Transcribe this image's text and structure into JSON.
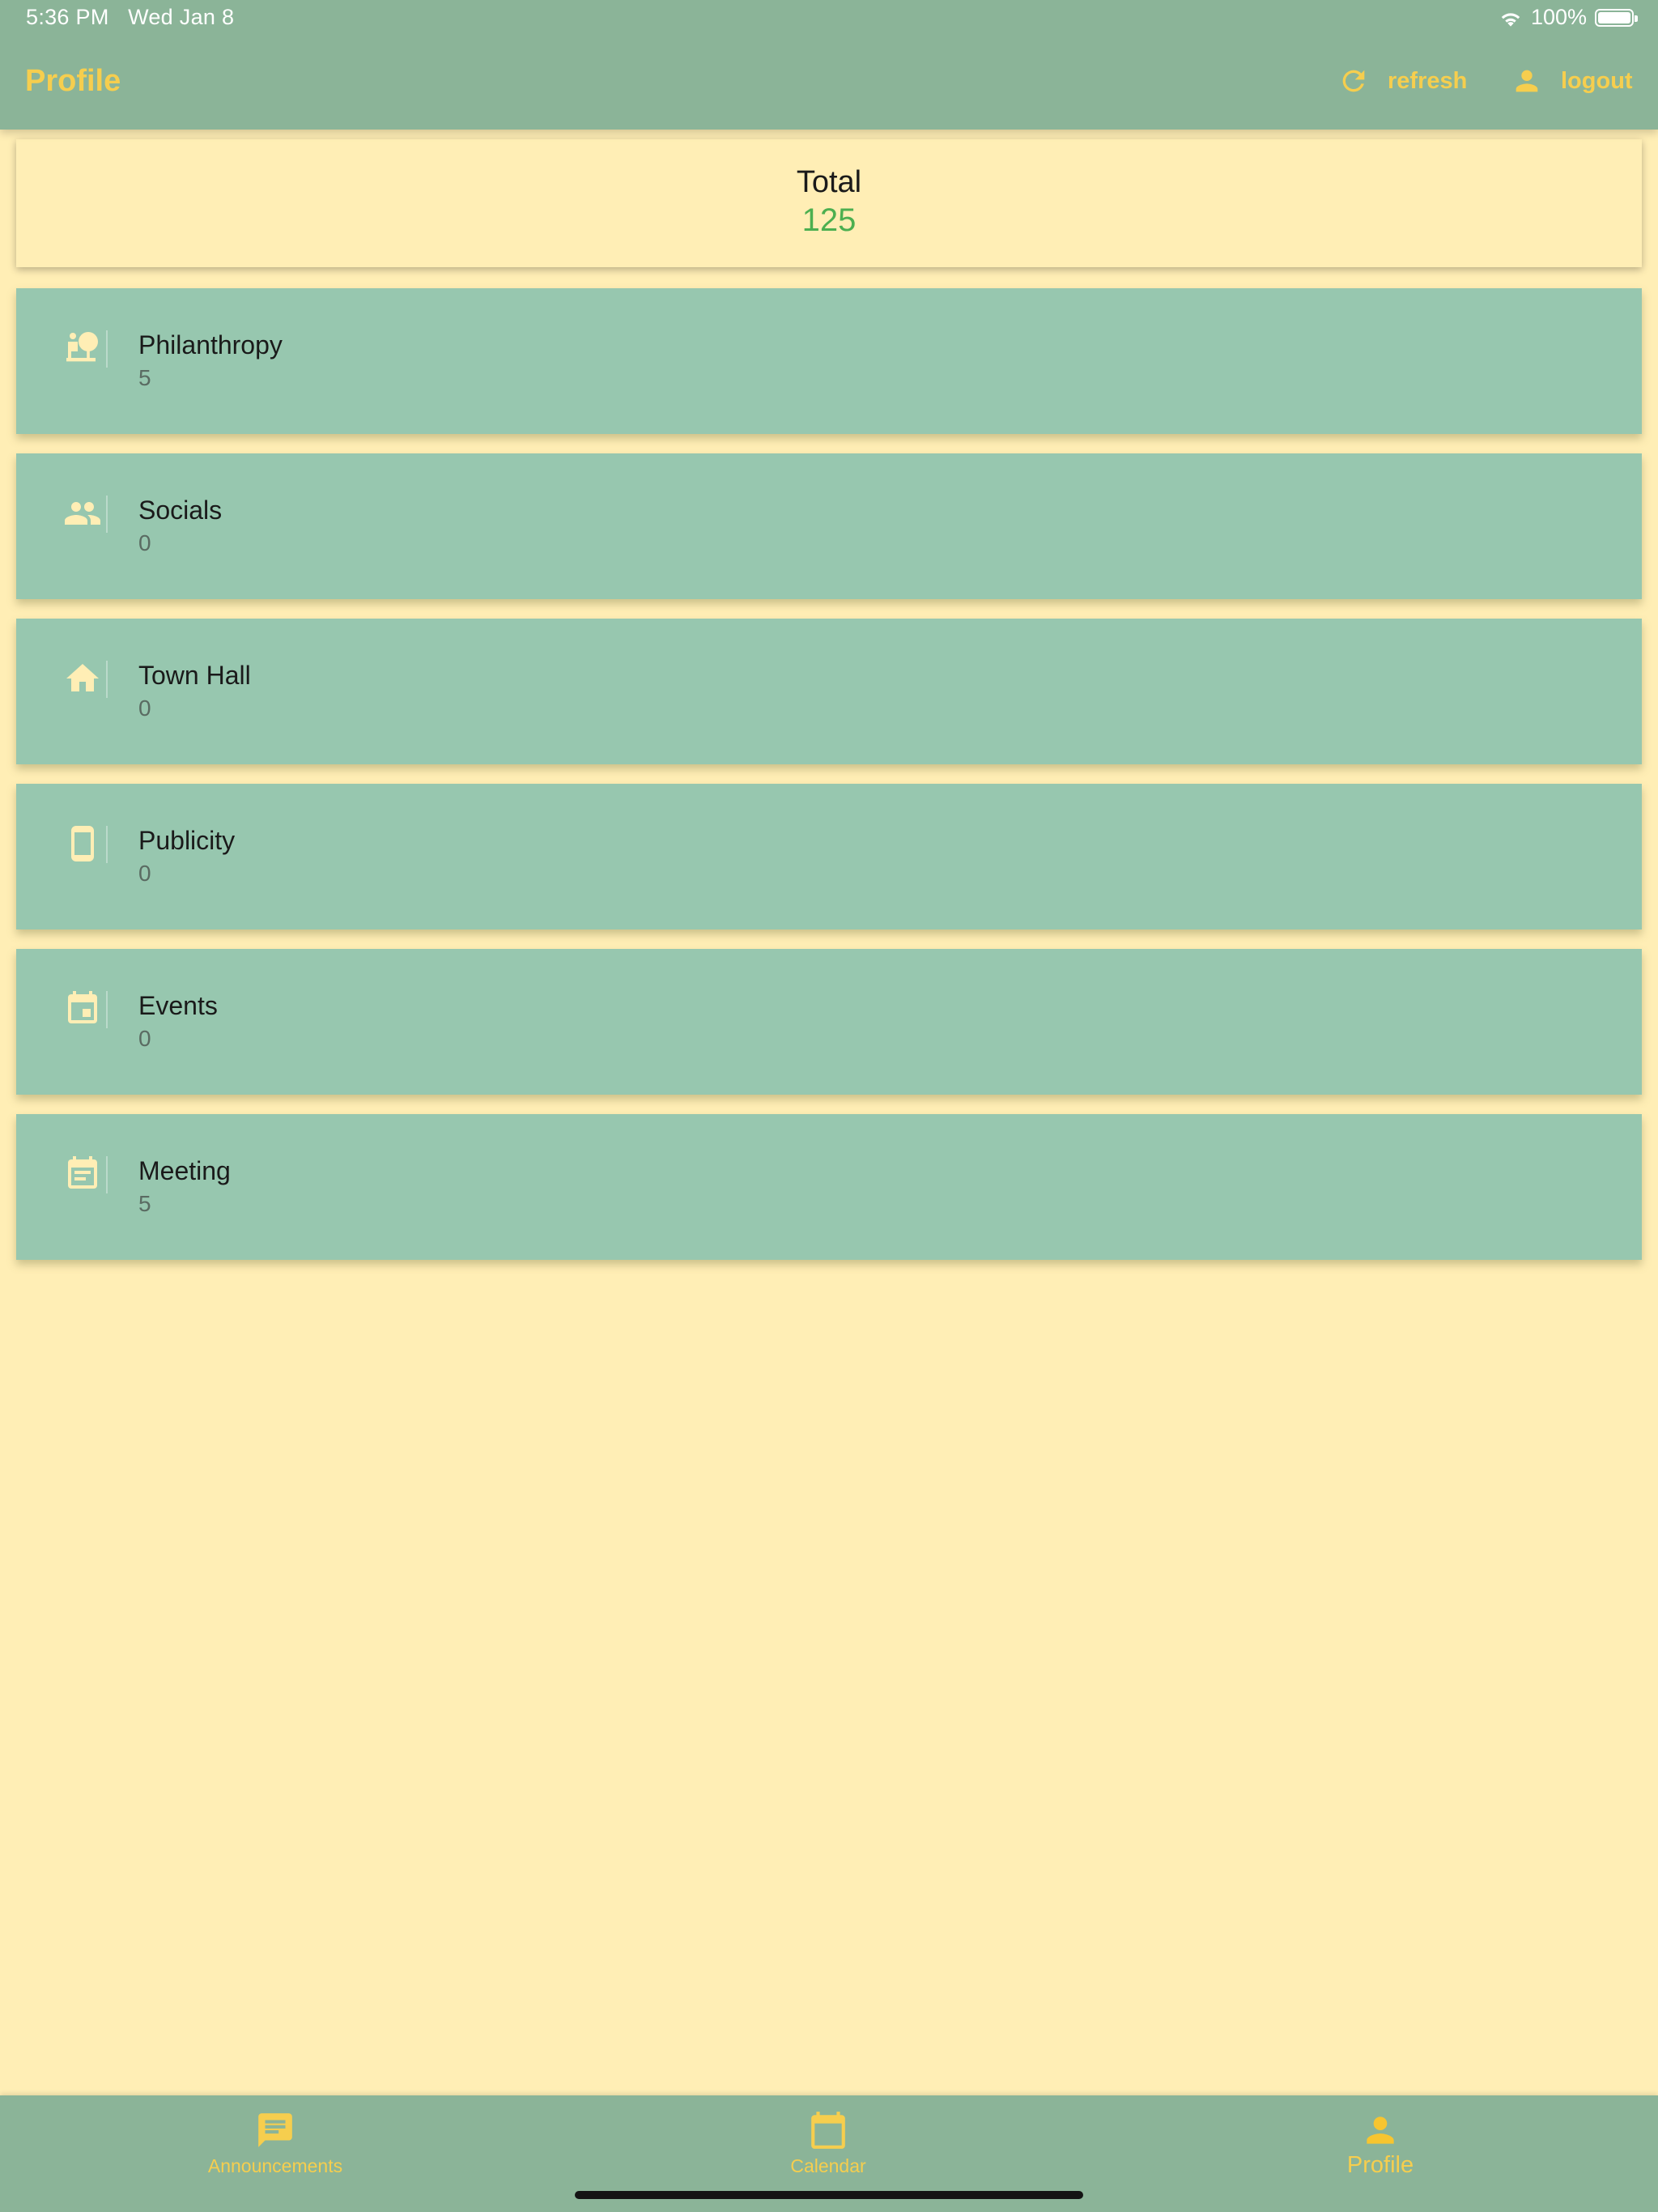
{
  "status_bar": {
    "time": "5:36 PM",
    "date": "Wed Jan 8",
    "battery": "100%"
  },
  "header": {
    "title": "Profile",
    "refresh_label": "refresh",
    "logout_label": "logout"
  },
  "total": {
    "label": "Total",
    "value": "125"
  },
  "categories": [
    {
      "name": "Philanthropy",
      "count": "5",
      "icon": "volunteer-icon"
    },
    {
      "name": "Socials",
      "count": "0",
      "icon": "people-icon"
    },
    {
      "name": "Town Hall",
      "count": "0",
      "icon": "home-icon"
    },
    {
      "name": "Publicity",
      "count": "0",
      "icon": "phone-icon"
    },
    {
      "name": "Events",
      "count": "0",
      "icon": "event-icon"
    },
    {
      "name": "Meeting",
      "count": "5",
      "icon": "event-note-icon"
    }
  ],
  "bottom_nav": {
    "items": [
      {
        "label": "Announcements",
        "icon": "chat-icon"
      },
      {
        "label": "Calendar",
        "icon": "calendar-icon"
      },
      {
        "label": "Profile",
        "icon": "person-icon"
      }
    ],
    "active": "Profile"
  },
  "colors": {
    "app_bar": "#8BB498",
    "background": "#FFEEB5",
    "card": "#97C7AF",
    "accent": "#F6CE4E",
    "total_value": "#4CAF50"
  }
}
